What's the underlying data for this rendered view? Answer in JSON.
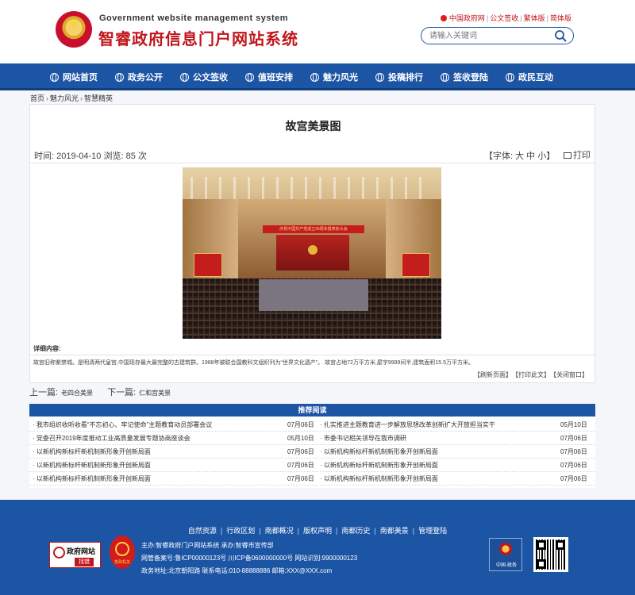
{
  "header": {
    "site_name_en": "Government website management system",
    "site_name_cn": "智睿政府信息门户网站系统",
    "top_links": [
      "中国政府网",
      "公文签收",
      "繁体版",
      "简体版"
    ],
    "search_placeholder": "请输入关键词"
  },
  "nav": {
    "items": [
      "网站首页",
      "政务公开",
      "公文签收",
      "值班安排",
      "魅力风光",
      "投稿排行",
      "签收登陆",
      "政民互动"
    ]
  },
  "breadcrumb": [
    "首页",
    "魅力风光",
    "智慧精英"
  ],
  "article": {
    "title": "故宫美景图",
    "time_label": "时间:",
    "date": "2019-04-10",
    "views_label": "浏览:",
    "views": "85",
    "views_unit": "次",
    "font_size_label": "【字体: 大 中 小】",
    "print_label": "打印",
    "photo_banner": "庆祝中国共产党成立95周年暨表彰大会",
    "detail_label": "详细内容:",
    "detail_text": "故宫旧称紫禁城。是明清两代皇宫,中国现存最大最完整的古建筑群。1988年被联合国教科文组织列为“世界文化遗产”。 故宫占地72万平方米,屋宇9999间半,建筑面积15.5万平方米。",
    "actions": [
      "【刷新页面】",
      "【打印此文】",
      "【关闭窗口】"
    ]
  },
  "prevnext": {
    "prev_label": "上一篇:",
    "prev_title": "老四合美景",
    "next_label": "下一篇:",
    "next_title": "仁和宫美景"
  },
  "recommended": {
    "heading": "推荐阅读",
    "rows": [
      [
        {
          "title": "· 我市组织收听收看“不忘初心、牢记使命”主题教育动员部署会议",
          "date": "07月06日"
        },
        {
          "title": "· 扎实推进主题教育进一步解放思想改革创新扩大开放担当实干",
          "date": "05月10日"
        }
      ],
      [
        {
          "title": "· 党委召开2019年度推动工业高质量发展专题协商座谈会",
          "date": "05月10日"
        },
        {
          "title": "· 市委书记相关领导在我市调研",
          "date": "07月06日"
        }
      ],
      [
        {
          "title": "· 以新机构新标杆新机制新形象开创新局面",
          "date": "07月06日"
        },
        {
          "title": "· 以新机构新标杆新机制新形象开创新局面",
          "date": "07月06日"
        }
      ],
      [
        {
          "title": "· 以新机构新标杆新机制新形象开创新局面",
          "date": "07月06日"
        },
        {
          "title": "· 以新机构新标杆新机制新形象开创新局面",
          "date": "07月06日"
        }
      ],
      [
        {
          "title": "· 以新机构新标杆新机制新形象开创新局面",
          "date": "07月06日"
        },
        {
          "title": "· 以新机构新标杆新机制新形象开创新局面",
          "date": "07月06日"
        }
      ]
    ]
  },
  "footer": {
    "links": [
      "自然资源",
      "行政区划",
      "南都概况",
      "版权声明",
      "南都历史",
      "南都美景",
      "管理登陆"
    ],
    "info_line1": "主办:智睿政府门户网站系统   承办:智睿市宣传部",
    "info_line2": "网管备案号:鲁ICP00000123号   川ICP备0600000000号   网站识别:9900000123",
    "info_line3": "政务地址:北京朝阳路   联系电话:010-88888886   邮箱:XXX@XXX.com",
    "badge_gov_text": "政府网站",
    "badge_gov_sub": "找错",
    "badge_dang_text": "党政机关",
    "badge_cn_text": "中国·政务"
  },
  "colors": {
    "brand_blue": "#1d55a5",
    "brand_red": "#c0161d"
  }
}
